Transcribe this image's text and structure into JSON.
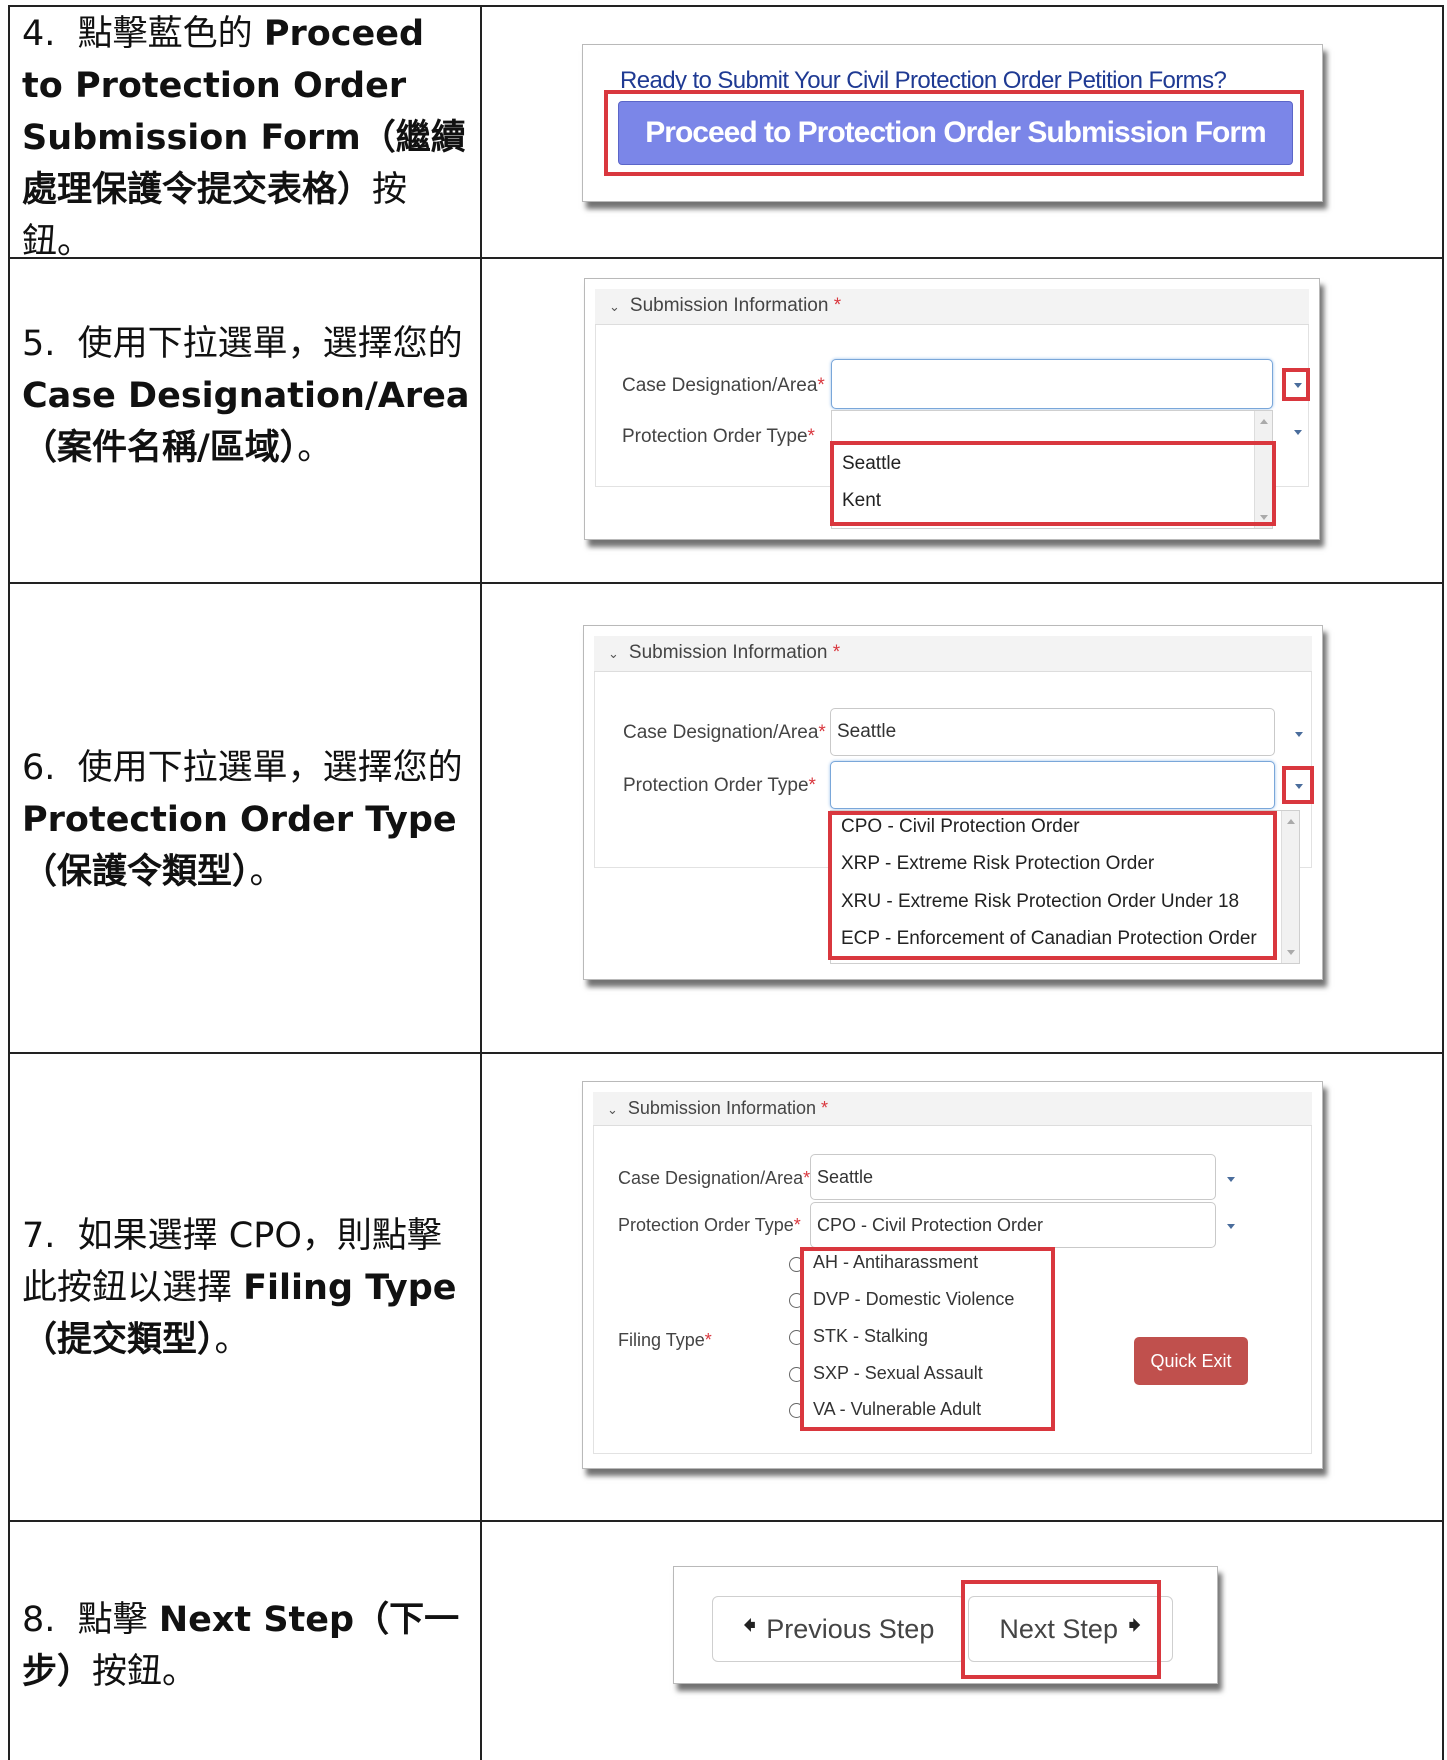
{
  "steps": [
    {
      "number": "4.",
      "text_a": "點擊藍色的 ",
      "bold_a": "Proceed to Protection Order Submission Form",
      "bold_b": "（繼續處理保護令提交表格）",
      "text_b": "按鈕。",
      "shot": {
        "heading": "Ready to Submit Your Civil Protection Order Petition Forms?",
        "button": "Proceed to Protection Order Submission Form"
      }
    },
    {
      "number": "5.",
      "text_a": "使用下拉選單，選擇您的 ",
      "bold_a": "Case Designation/Area",
      "bold_b": "（案件名稱/區域）",
      "text_b": "。",
      "shot": {
        "section_title": "Submission Information",
        "required_mark": "*",
        "case_label": "Case Designation/Area",
        "type_label": "Protection Order Type",
        "case_value": "",
        "options": [
          "Seattle",
          "Kent"
        ]
      }
    },
    {
      "number": "6.",
      "text_a": "使用下拉選單，選擇您的 ",
      "bold_a": "Protection Order Type",
      "bold_b": "（保護令類型）",
      "text_b": "。",
      "shot": {
        "section_title": "Submission Information",
        "required_mark": "*",
        "case_label": "Case Designation/Area",
        "type_label": "Protection Order Type",
        "case_value": "Seattle",
        "options": [
          "CPO - Civil Protection Order",
          "XRP - Extreme Risk Protection Order",
          "XRU - Extreme Risk Protection Order Under 18",
          "ECP - Enforcement of Canadian Protection Order"
        ]
      }
    },
    {
      "number": "7.",
      "text_a": "如果選擇 CPO，則點擊此按鈕以選擇 ",
      "bold_a": "Filing Type",
      "bold_b": "（提交類型）",
      "text_b": "。",
      "shot": {
        "section_title": "Submission Information",
        "required_mark": "*",
        "case_label": "Case Designation/Area",
        "type_label": "Protection Order Type",
        "filing_label": "Filing Type",
        "case_value": "Seattle",
        "type_value": "CPO - Civil Protection Order",
        "filing_options": [
          "AH - Antiharassment",
          "DVP - Domestic Violence",
          "STK - Stalking",
          "SXP - Sexual Assault",
          "VA - Vulnerable Adult"
        ],
        "quick_exit": "Quick Exit"
      }
    },
    {
      "number": "8.",
      "text_a": "點擊 ",
      "bold_a": "Next Step",
      "bold_b": "（下一步）",
      "text_b": "按鈕。",
      "shot": {
        "prev_label": "Previous Step",
        "next_label": "Next Step",
        "prev_arrow": "🠸",
        "next_arrow": "🠺"
      }
    }
  ],
  "colors": {
    "highlight_red": "#d9373e",
    "primary_button": "#7b86e8",
    "heading_blue": "#1f3a93",
    "quick_exit": "#c0504d"
  },
  "icons": [
    "chevron-down-icon",
    "caret-down-icon",
    "radio-icon",
    "arrow-left-icon",
    "arrow-right-icon"
  ]
}
